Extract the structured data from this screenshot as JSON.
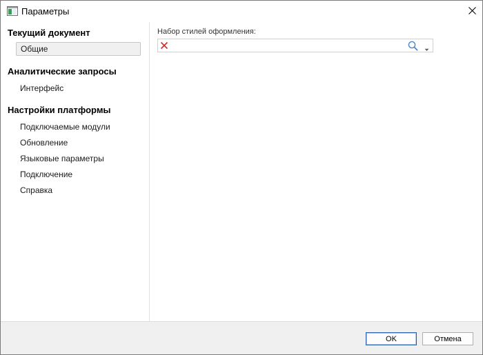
{
  "window": {
    "title": "Параметры"
  },
  "sidebar": {
    "sections": [
      {
        "header": "Текущий документ",
        "items": [
          {
            "label": "Общие",
            "selected": true
          }
        ]
      },
      {
        "header": "Аналитические запросы",
        "items": [
          {
            "label": "Интерфейс",
            "selected": false
          }
        ]
      },
      {
        "header": "Настройки платформы",
        "items": [
          {
            "label": "Подключаемые модули",
            "selected": false
          },
          {
            "label": "Обновление",
            "selected": false
          },
          {
            "label": "Языковые параметры",
            "selected": false
          },
          {
            "label": "Подключение",
            "selected": false
          },
          {
            "label": "Справка",
            "selected": false
          }
        ]
      }
    ]
  },
  "main": {
    "style_set_label": "Набор стилей оформления:",
    "style_set_value": ""
  },
  "footer": {
    "ok_label": "OK",
    "cancel_label": "Отмена"
  },
  "colors": {
    "accent_border": "#2b5ea8",
    "clear_icon": "#d22a2a",
    "footer_bg": "#f0f0f0"
  }
}
